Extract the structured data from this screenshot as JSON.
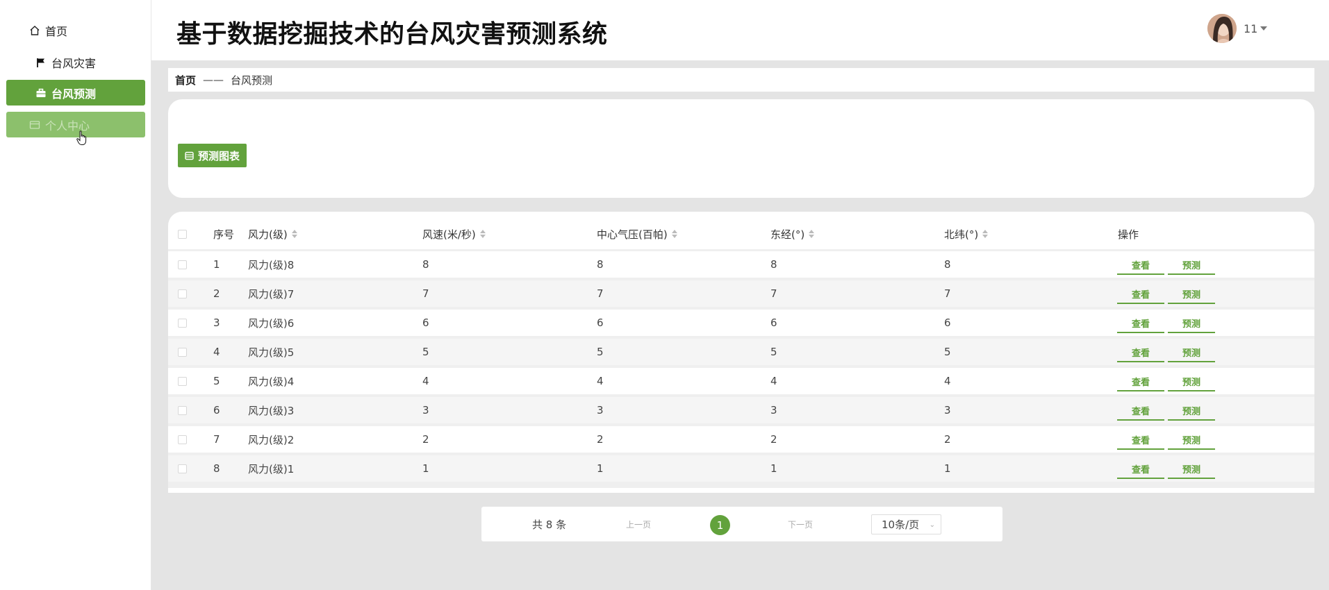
{
  "sidebar": {
    "items": [
      {
        "label": "首页",
        "icon": "home-icon"
      },
      {
        "label": "台风灾害",
        "icon": "flag-icon"
      },
      {
        "label": "台风预测",
        "icon": "briefcase-icon",
        "state": "active"
      },
      {
        "label": "个人中心",
        "icon": "card-icon",
        "state": "hover"
      }
    ]
  },
  "header": {
    "title": "基于数据挖掘技术的台风灾害预测系统",
    "username": "11"
  },
  "breadcrumb": {
    "home": "首页",
    "separator": "——",
    "current": "台风预测"
  },
  "actions": {
    "chart_button": "预测图表"
  },
  "table": {
    "columns": [
      "序号",
      "风力(级)",
      "风速(米/秒)",
      "中心气压(百帕)",
      "东经(°)",
      "北纬(°)",
      "操作"
    ],
    "rows": [
      {
        "index": "1",
        "wind_level": "风力(级)8",
        "wind_speed": "8",
        "pressure": "8",
        "longitude": "8",
        "latitude": "8"
      },
      {
        "index": "2",
        "wind_level": "风力(级)7",
        "wind_speed": "7",
        "pressure": "7",
        "longitude": "7",
        "latitude": "7"
      },
      {
        "index": "3",
        "wind_level": "风力(级)6",
        "wind_speed": "6",
        "pressure": "6",
        "longitude": "6",
        "latitude": "6"
      },
      {
        "index": "4",
        "wind_level": "风力(级)5",
        "wind_speed": "5",
        "pressure": "5",
        "longitude": "5",
        "latitude": "5"
      },
      {
        "index": "5",
        "wind_level": "风力(级)4",
        "wind_speed": "4",
        "pressure": "4",
        "longitude": "4",
        "latitude": "4"
      },
      {
        "index": "6",
        "wind_level": "风力(级)3",
        "wind_speed": "3",
        "pressure": "3",
        "longitude": "3",
        "latitude": "3"
      },
      {
        "index": "7",
        "wind_level": "风力(级)2",
        "wind_speed": "2",
        "pressure": "2",
        "longitude": "2",
        "latitude": "2"
      },
      {
        "index": "8",
        "wind_level": "风力(级)1",
        "wind_speed": "1",
        "pressure": "1",
        "longitude": "1",
        "latitude": "1"
      }
    ],
    "view_label": "查看",
    "predict_label": "预测"
  },
  "pagination": {
    "total": "共 8 条",
    "prev": "上一页",
    "current_page": "1",
    "next": "下一页",
    "page_size": "10条/页"
  },
  "colors": {
    "accent": "#62a23c",
    "accent_hover": "#8cc06c",
    "background": "#e4e4e4"
  }
}
